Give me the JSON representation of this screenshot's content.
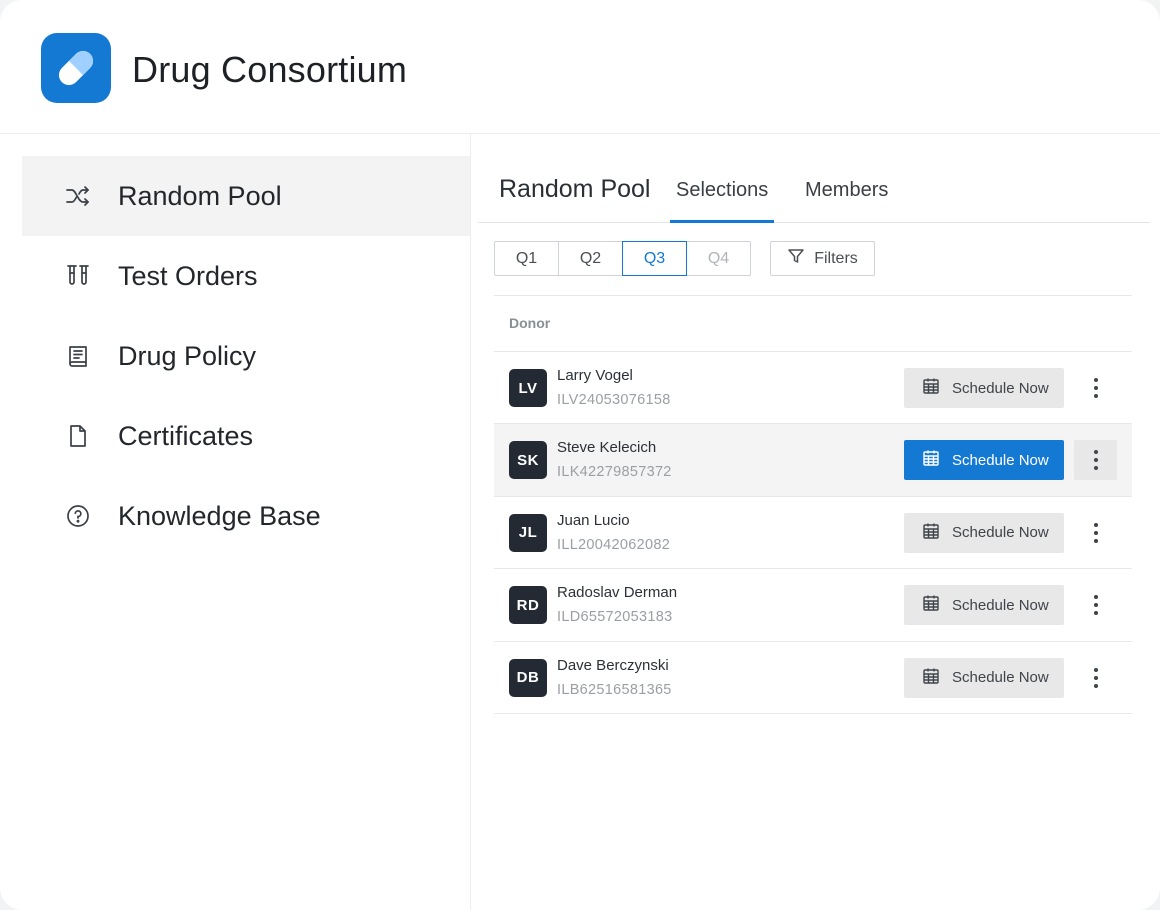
{
  "app": {
    "title": "Drug Consortium",
    "logo_icon": "pill-icon",
    "accent": "#1479d2"
  },
  "sidebar": {
    "items": [
      {
        "label": "Random Pool",
        "icon": "shuffle-icon",
        "active": true
      },
      {
        "label": "Test Orders",
        "icon": "test-tubes-icon",
        "active": false
      },
      {
        "label": "Drug Policy",
        "icon": "book-icon",
        "active": false
      },
      {
        "label": "Certificates",
        "icon": "document-icon",
        "active": false
      },
      {
        "label": "Knowledge Base",
        "icon": "help-circle-icon",
        "active": false
      }
    ]
  },
  "main": {
    "title": "Random Pool",
    "tabs": [
      {
        "label": "Selections",
        "active": true
      },
      {
        "label": "Members",
        "active": false
      }
    ],
    "quarters": [
      {
        "label": "Q1",
        "state": "normal"
      },
      {
        "label": "Q2",
        "state": "normal"
      },
      {
        "label": "Q3",
        "state": "active"
      },
      {
        "label": "Q4",
        "state": "disabled"
      }
    ],
    "filters_label": "Filters",
    "table": {
      "column_donor": "Donor",
      "action_label": "Schedule Now",
      "rows": [
        {
          "initials": "LV",
          "name": "Larry Vogel",
          "id": "ILV24053076158"
        },
        {
          "initials": "SK",
          "name": "Steve Kelecich",
          "id": "ILK42279857372"
        },
        {
          "initials": "JL",
          "name": "Juan Lucio",
          "id": "ILL20042062082"
        },
        {
          "initials": "RD",
          "name": "Radoslav Derman",
          "id": "ILD65572053183"
        },
        {
          "initials": "DB",
          "name": "Dave Berczynski",
          "id": "ILB62516581365"
        }
      ]
    }
  }
}
